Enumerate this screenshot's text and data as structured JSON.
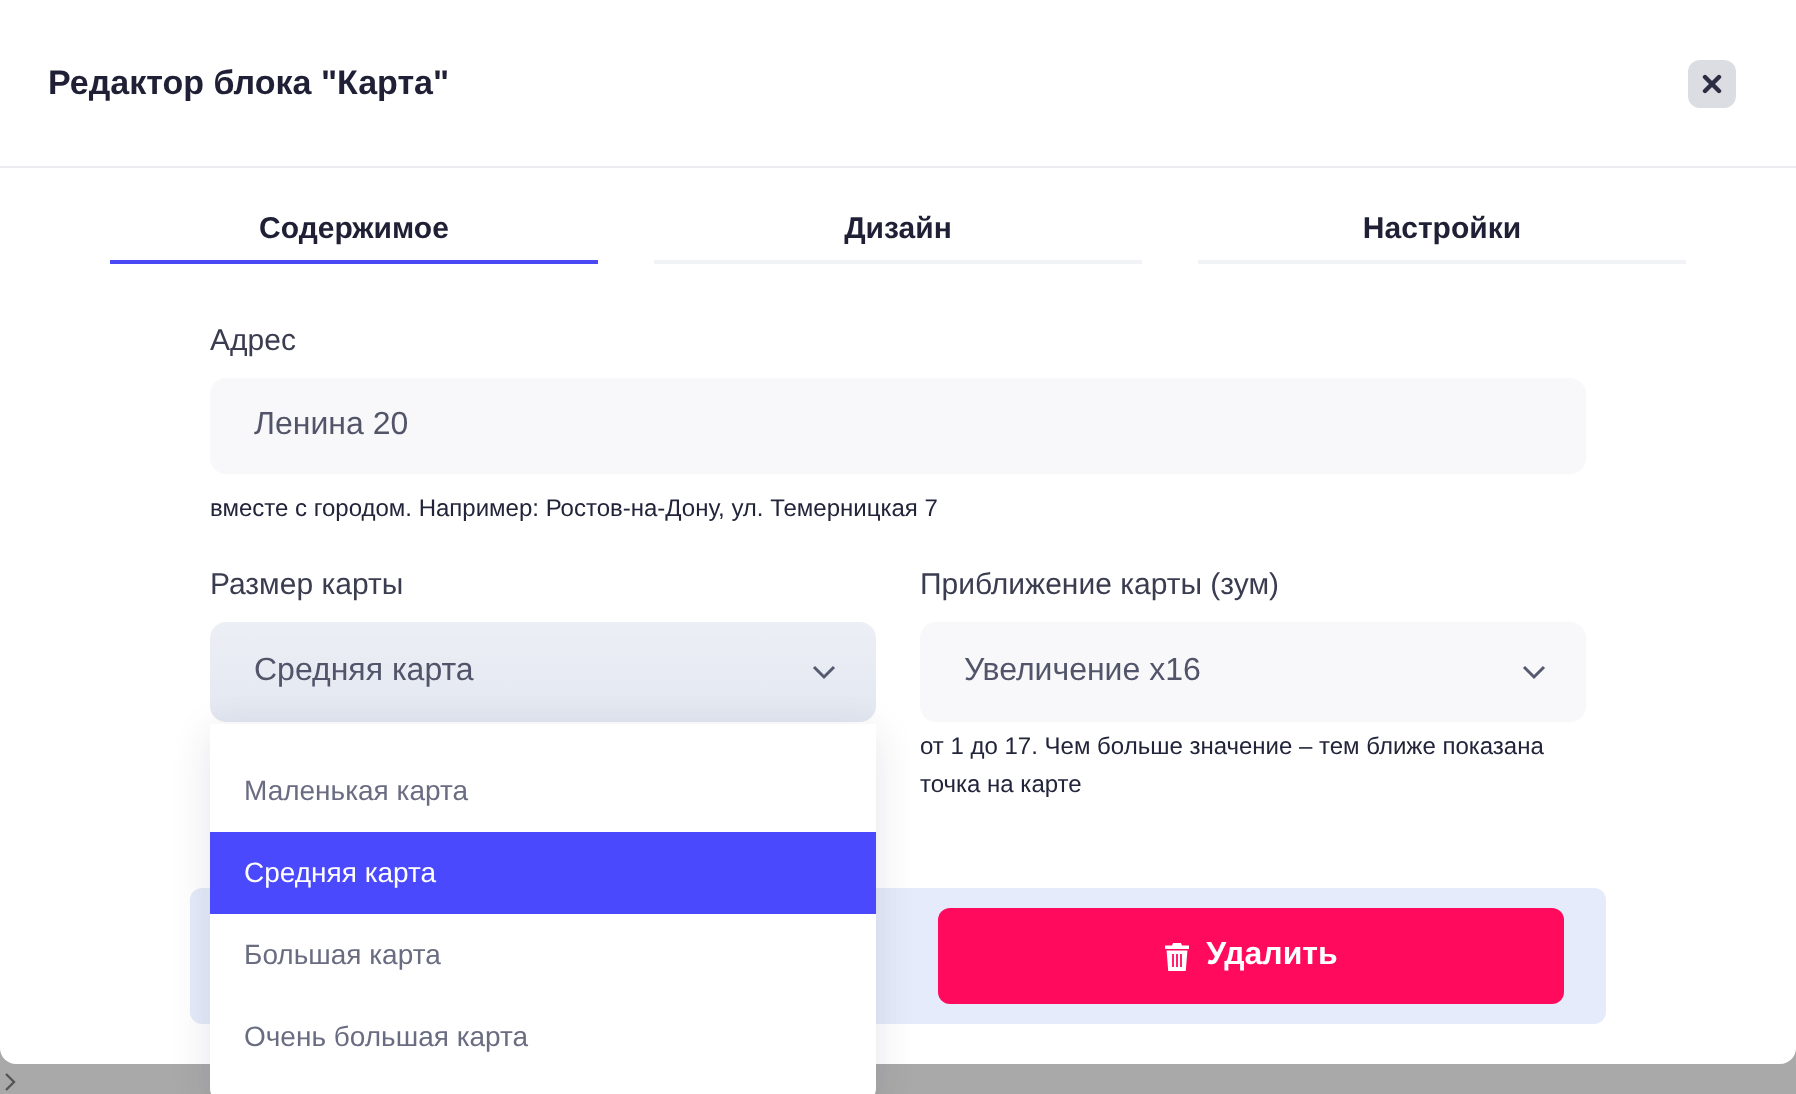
{
  "dialog": {
    "title": "Редактор блока \"Карта\""
  },
  "tabs": [
    {
      "label": "Содержимое",
      "selected": true
    },
    {
      "label": "Дизайн",
      "selected": false
    },
    {
      "label": "Настройки",
      "selected": false
    }
  ],
  "address": {
    "label": "Адрес",
    "value": "Ленина 20",
    "hint": "вместе с городом. Например: Ростов-на-Дону, ул. Темерницкая 7"
  },
  "map_size": {
    "label": "Размер карты",
    "value": "Средняя карта",
    "expanded": true,
    "options": [
      {
        "label": "Маленькая карта",
        "selected": false
      },
      {
        "label": "Средняя карта",
        "selected": true
      },
      {
        "label": "Большая карта",
        "selected": false
      },
      {
        "label": "Очень большая карта",
        "selected": false
      }
    ]
  },
  "zoom": {
    "label": "Приближение карты (зум)",
    "value": "Увеличение x16",
    "hint": "от 1 до 17. Чем больше значение – тем ближе показана точка на карте"
  },
  "delete_button": {
    "label": "Удалить"
  }
}
